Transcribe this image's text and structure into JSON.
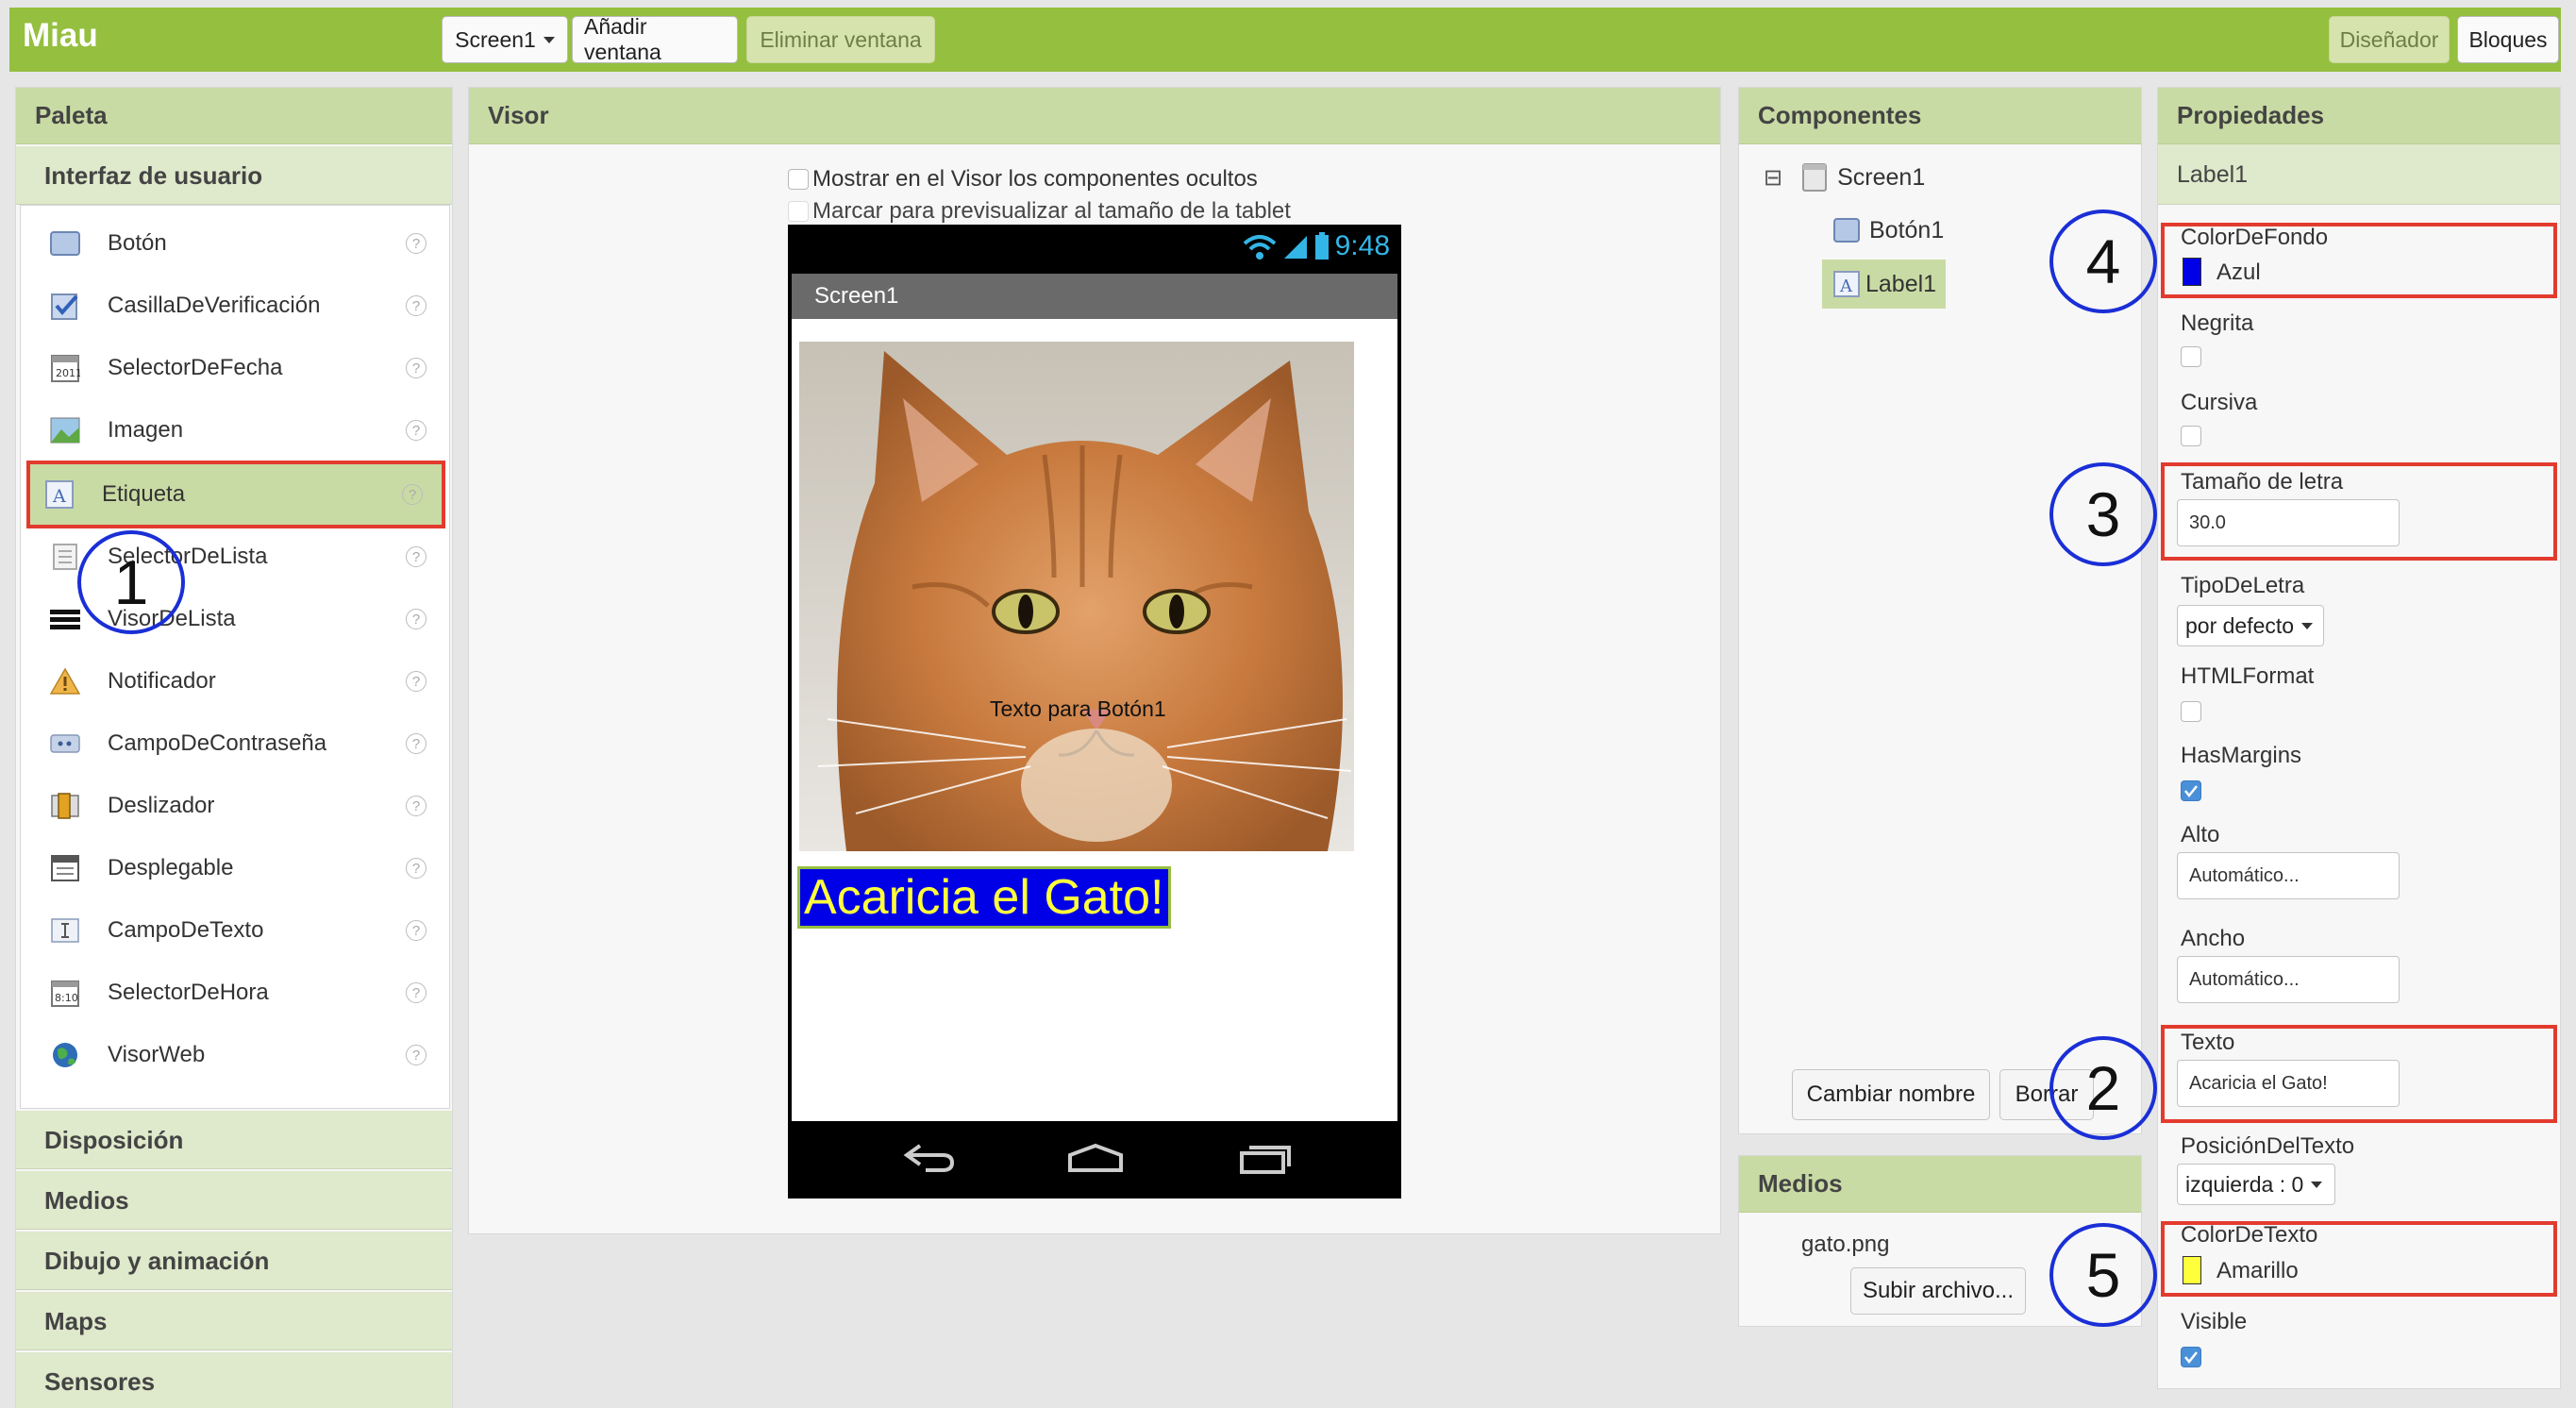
{
  "app": {
    "title": "Miau"
  },
  "toolbar": {
    "screen_select": "Screen1",
    "add_screen": "Añadir ventana",
    "remove_screen": "Eliminar ventana",
    "designer": "Diseñador",
    "blocks": "Bloques"
  },
  "palette": {
    "title": "Paleta",
    "open_section": "Interfaz de usuario",
    "items": [
      {
        "label": "Botón",
        "icon": "button-icon"
      },
      {
        "label": "CasillaDeVerificación",
        "icon": "checkbox-icon"
      },
      {
        "label": "SelectorDeFecha",
        "icon": "calendar-icon"
      },
      {
        "label": "Imagen",
        "icon": "image-icon"
      },
      {
        "label": "Etiqueta",
        "icon": "label-icon"
      },
      {
        "label": "SelectorDeLista",
        "icon": "list-picker-icon"
      },
      {
        "label": "VisorDeLista",
        "icon": "list-view-icon"
      },
      {
        "label": "Notificador",
        "icon": "warning-icon"
      },
      {
        "label": "CampoDeContraseña",
        "icon": "password-icon"
      },
      {
        "label": "Deslizador",
        "icon": "slider-icon"
      },
      {
        "label": "Desplegable",
        "icon": "spinner-icon"
      },
      {
        "label": "CampoDeTexto",
        "icon": "textbox-icon"
      },
      {
        "label": "SelectorDeHora",
        "icon": "clock-icon"
      },
      {
        "label": "VisorWeb",
        "icon": "globe-icon"
      }
    ],
    "help_glyph": "?",
    "sections": [
      "Disposición",
      "Medios",
      "Dibujo y animación",
      "Maps",
      "Sensores"
    ]
  },
  "viewer": {
    "title": "Visor",
    "show_hidden": "Mostrar en el Visor los componentes ocultos",
    "tablet_preview": "Marcar para previsualizar al tamaño de la tablet",
    "phone_time": "9:48",
    "screen_title": "Screen1",
    "button_text": "Texto para Botón1",
    "label_text": "Acaricia el Gato!"
  },
  "components": {
    "title": "Componentes",
    "tree": [
      "Screen1",
      "Botón1",
      "Label1"
    ],
    "collapse_glyph": "⊟",
    "rename": "Cambiar nombre",
    "delete": "Borrar"
  },
  "media": {
    "title": "Medios",
    "file": "gato.png",
    "upload": "Subir archivo..."
  },
  "properties": {
    "title": "Propiedades",
    "component": "Label1",
    "bg_color_label": "ColorDeFondo",
    "bg_color_value": "Azul",
    "bold_label": "Negrita",
    "italic_label": "Cursiva",
    "font_size_label": "Tamaño de letra",
    "font_size_value": "30.0",
    "typeface_label": "TipoDeLetra",
    "typeface_value": "por defecto",
    "html_label": "HTMLFormat",
    "margins_label": "HasMargins",
    "height_label": "Alto",
    "height_value": "Automático...",
    "width_label": "Ancho",
    "width_value": "Automático...",
    "text_label": "Texto",
    "text_value": "Acaricia el Gato!",
    "align_label": "PosiciónDelTexto",
    "align_value": "izquierda : 0",
    "text_color_label": "ColorDeTexto",
    "text_color_value": "Amarillo",
    "visible_label": "Visible"
  },
  "callouts": [
    "1",
    "2",
    "3",
    "4",
    "5"
  ],
  "colors": {
    "accent_green": "#95bf3f",
    "highlight_red": "#e23b2e",
    "callout_blue": "#1a2fd6",
    "label_bg_blue": "#0000e6",
    "label_fg_yellow": "#ffff3c"
  }
}
